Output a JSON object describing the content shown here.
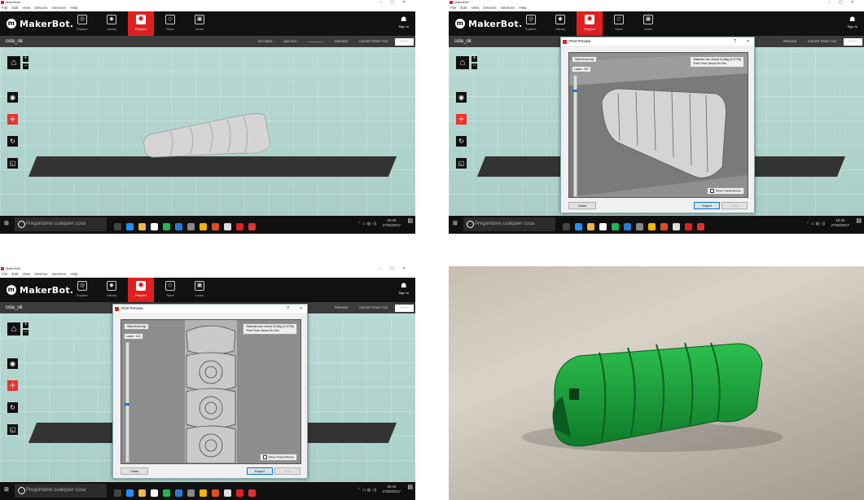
{
  "app": {
    "window_title": "MakerBot*",
    "menu": [
      "File",
      "Edit",
      "View",
      "Devices",
      "Services",
      "Help"
    ],
    "logo_text": "MakerBot.",
    "nav": [
      "Explore",
      "Library",
      "Prepare",
      "Store",
      "Learn"
    ],
    "active_nav": "Prepare",
    "sign_in": "Sign In",
    "filename": "cola_ok",
    "subbar_buttons": [
      "SETTINGS",
      "ADD FILE",
      "PREVIEW",
      "EXPORT PRINT FILE"
    ],
    "print_button": "PRINT"
  },
  "taskbar": {
    "search_placeholder": "Pregúntame cualquier cosa",
    "dates": [
      "27/02/2017",
      "27/02/2017",
      "27/02/2017"
    ],
    "times": [
      "15:40",
      "15:42",
      "15:44"
    ]
  },
  "dialogs": [
    {
      "title": "Print Preview",
      "help": "?",
      "close_x": "×",
      "view_from_top": "View from top",
      "layer_label": "Layer: 257",
      "material": "Material Use: About 34.86g (0.077lb)",
      "print_time": "Print Time: About 2h 15m",
      "show_travel": "Show Travel Moves",
      "close_button": "Close",
      "export_button": "Export",
      "print_button": "Print",
      "slider_level": 0.12
    },
    {
      "title": "Print Preview",
      "help": "?",
      "close_x": "×",
      "view_from_top": "View from top",
      "layer_label": "Layer: 121",
      "material": "Material Use: About 34.86g (0.077lb)",
      "print_time": "Print Time: About 2h 15m",
      "show_travel": "Show Travel Moves",
      "close_button": "Close",
      "export_button": "Export",
      "print_button": "Print",
      "slider_level": 0.52
    }
  ],
  "colors": {
    "brand_red": "#e02020",
    "navbar": "#111111",
    "viewport": "#b0d3ce",
    "model": "#d8d8d8",
    "printed_part": "#1a9a3a"
  },
  "icons": [
    "home-icon",
    "zoom-in-icon",
    "zoom-out-icon",
    "eye-icon",
    "move-icon",
    "rotate-icon",
    "scale-icon",
    "windows-start-icon",
    "cortana-icon"
  ]
}
